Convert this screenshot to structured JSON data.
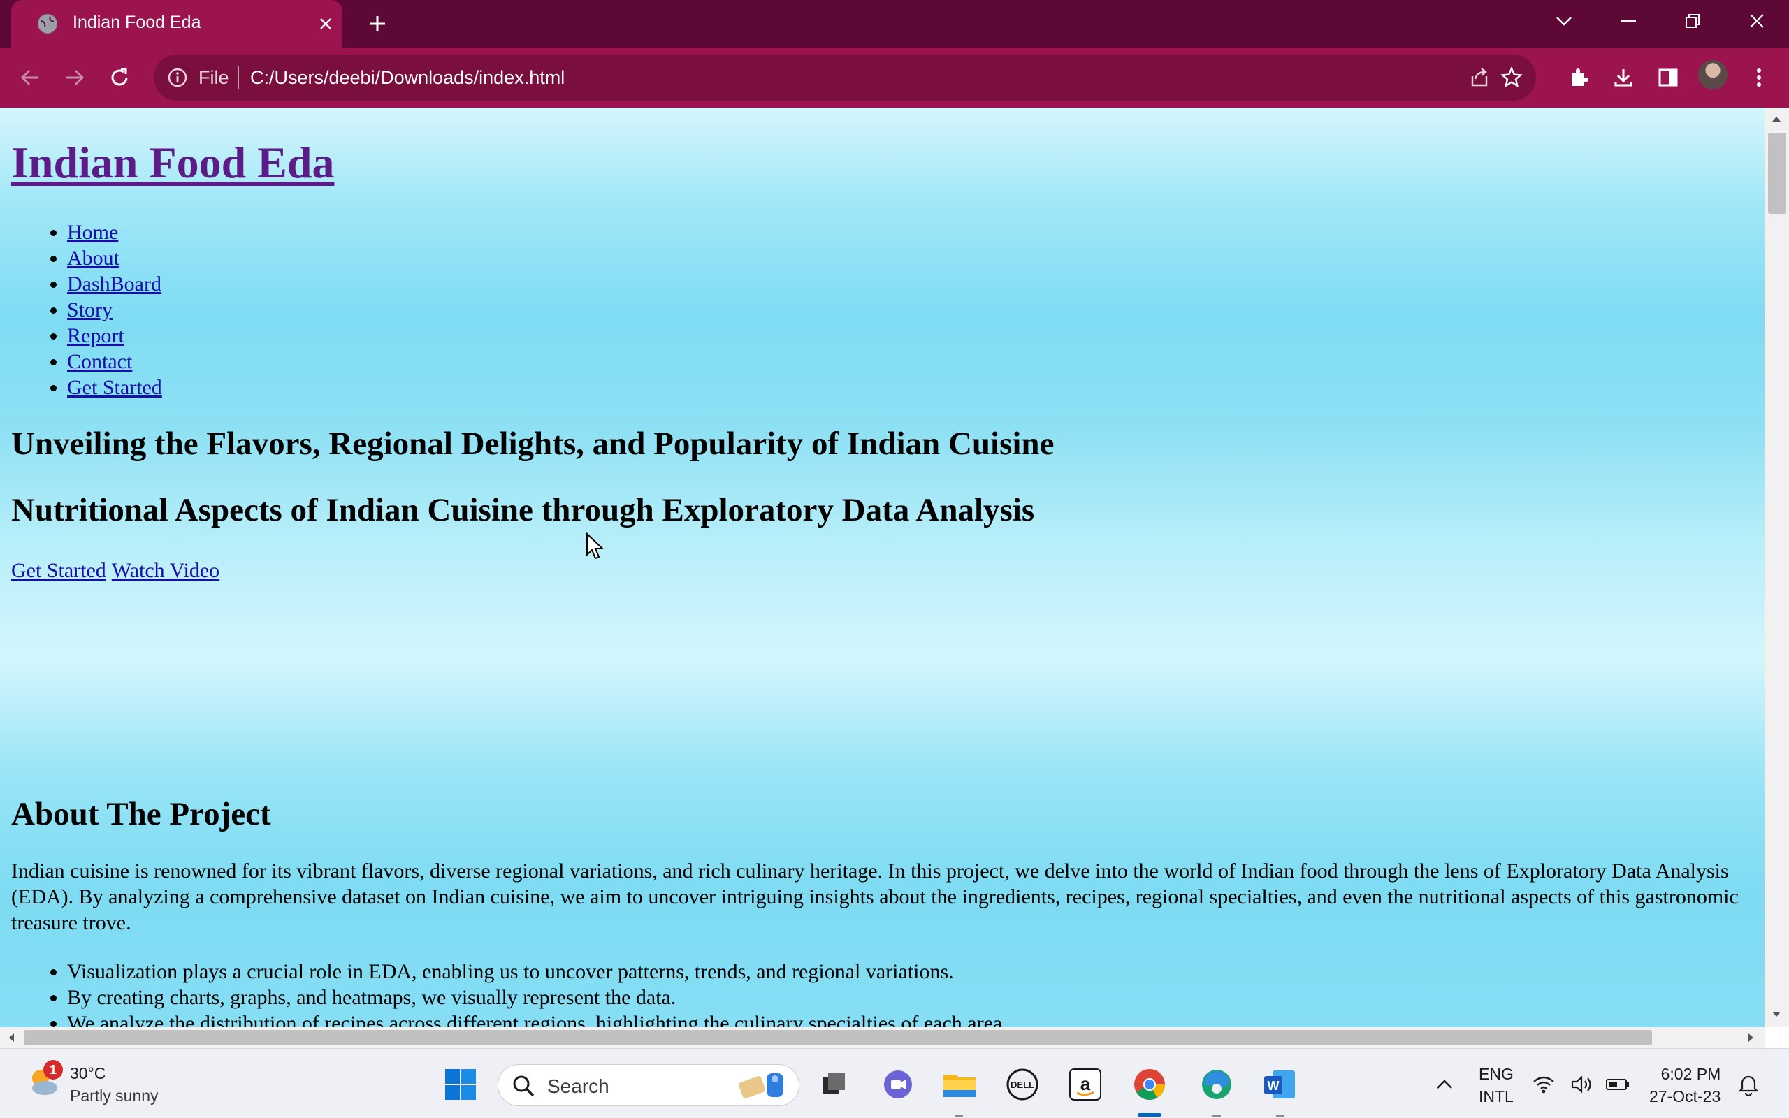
{
  "browser": {
    "tab_title": "Indian Food Eda",
    "omnibox_scheme": "File",
    "url": "C:/Users/deebi/Downloads/index.html"
  },
  "page": {
    "site_title": "Indian Food Eda",
    "nav": [
      "Home",
      "About",
      "DashBoard",
      "Story",
      "Report",
      "Contact",
      "Get Started"
    ],
    "headline_1": "Unveiling the Flavors, Regional Delights, and Popularity of Indian Cuisine",
    "headline_2": "Nutritional Aspects of Indian Cuisine through Exploratory Data Analysis",
    "cta_get_started": "Get Started",
    "cta_watch_video": "Watch Video",
    "about_title": "About The Project",
    "about_paragraph": "Indian cuisine is renowned for its vibrant flavors, diverse regional variations, and rich culinary heritage. In this project, we delve into the world of Indian food through the lens of Exploratory Data Analysis (EDA). By analyzing a comprehensive dataset on Indian cuisine, we aim to uncover intriguing insights about the ingredients, recipes, regional specialties, and even the nutritional aspects of this gastronomic treasure trove.",
    "about_points": [
      "Visualization plays a crucial role in EDA, enabling us to uncover patterns, trends, and regional variations.",
      "By creating charts, graphs, and heatmaps, we visually represent the data.",
      "We analyze the distribution of recipes across different regions, highlighting the culinary specialties of each area."
    ]
  },
  "taskbar": {
    "weather_badge": "1",
    "weather_temp": "30°C",
    "weather_desc": "Partly sunny",
    "search_label": "Search",
    "lang_1": "ENG",
    "lang_2": "INTL",
    "time": "6:02 PM",
    "date": "27-Oct-23"
  },
  "colors": {
    "titlebar": "#5e0935",
    "toolbar": "#9b134f",
    "visited_link": "#5b1c87",
    "link": "#1a0dab"
  }
}
